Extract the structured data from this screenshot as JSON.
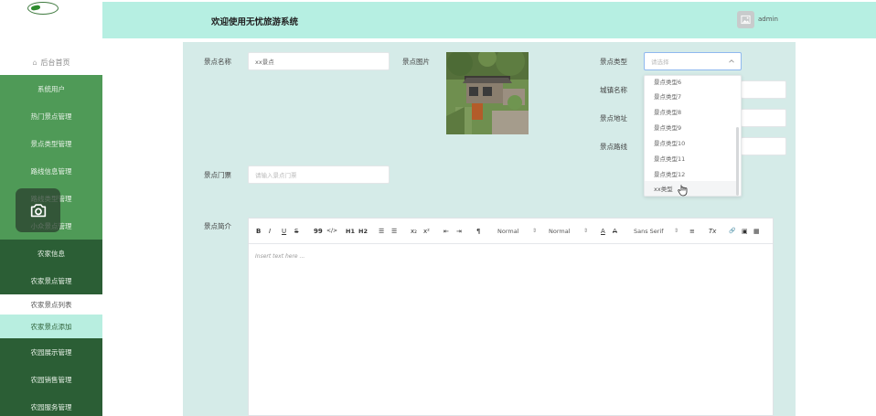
{
  "header": {
    "title": "欢迎使用无忧旅游系统",
    "user": "admin"
  },
  "sidebar": {
    "home": "后台首页",
    "items": [
      "系统用户",
      "热门景点管理",
      "景点类型管理",
      "路线信息管理",
      "路线类型管理",
      "小众景点管理",
      "农家信息",
      "农家景点管理",
      "农家景点列表",
      "农家景点添加",
      "农园展示管理",
      "农园销售管理",
      "农园服务管理"
    ]
  },
  "form": {
    "name_label": "景点名称",
    "name_value": "xx景点",
    "image_label": "景点图片",
    "type_label": "景点类型",
    "type_placeholder": "请选择",
    "city_label": "城镇名称",
    "address_label": "景点地址",
    "route_label": "景点路线",
    "ticket_label": "景点门票",
    "ticket_placeholder": "请输入景点门票",
    "intro_label": "景点简介"
  },
  "dropdown": {
    "options": [
      "景点类型6",
      "景点类型7",
      "景点类型8",
      "景点类型9",
      "景点类型10",
      "景点类型11",
      "景点类型12",
      "xx类型"
    ],
    "hovered": "xx类型"
  },
  "editor": {
    "toolbar": {
      "bold": "B",
      "italic": "I",
      "underline": "U",
      "strike": "S",
      "quote": "99",
      "code": "</>",
      "h1": "H1",
      "h2": "H2",
      "ol": "☰",
      "ul": "☰",
      "sub": "x₂",
      "sup": "x²",
      "outdent": "⇤",
      "indent": "⇥",
      "direction": "¶",
      "size": "Normal",
      "header": "Normal",
      "color": "A",
      "bg": "A",
      "font": "Sans Serif",
      "align": "≡",
      "clean": "Tx",
      "link": "🔗",
      "image": "▣",
      "video": "▦"
    },
    "placeholder": "Insert text here ..."
  },
  "colors": {
    "sidebar_light": "#4f9a57",
    "sidebar_dark": "#2b5e35",
    "sidebar_active": "#b8eee0",
    "header_bg": "#b6efe2",
    "content_bg": "#d5ebe8"
  }
}
